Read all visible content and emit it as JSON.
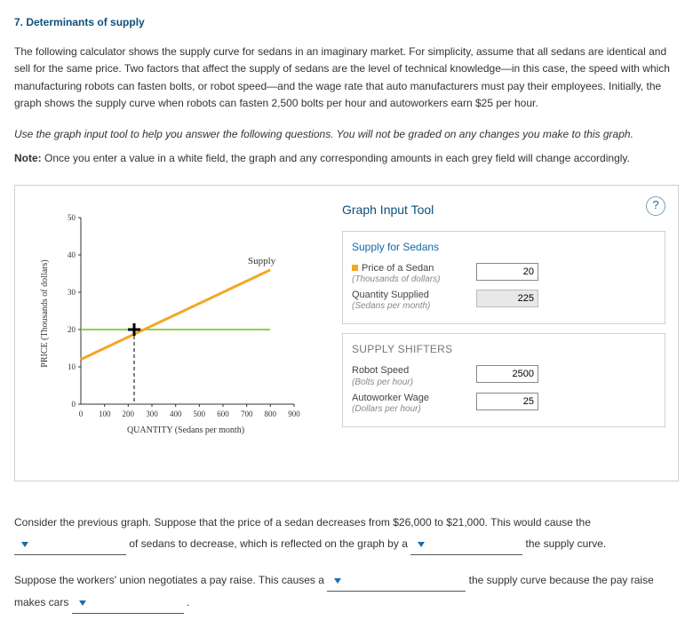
{
  "title": "7. Determinants of supply",
  "intro": "The following calculator shows the supply curve for sedans in an imaginary market. For simplicity, assume that all sedans are identical and sell for the same price. Two factors that affect the supply of sedans are the level of technical knowledge—in this case, the speed with which manufacturing robots can fasten bolts, or robot speed—and the wage rate that auto manufacturers must pay their employees. Initially, the graph shows the supply curve when robots can fasten 2,500 bolts per hour and autoworkers earn $25 per hour.",
  "instructions": "Use the graph input tool to help you answer the following questions. You will not be graded on any changes you make to this graph.",
  "note_label": "Note:",
  "note_text": " Once you enter a value in a white field, the graph and any corresponding amounts in each grey field will change accordingly.",
  "tool": {
    "header": "Graph Input Tool",
    "help": "?",
    "section1_title": "Supply for Sedans",
    "price_label": "Price of a Sedan",
    "price_sub": "(Thousands of dollars)",
    "price_value": "20",
    "qty_label": "Quantity Supplied",
    "qty_sub": "(Sedans per month)",
    "qty_value": "225",
    "section2_title": "SUPPLY SHIFTERS",
    "robot_label": "Robot Speed",
    "robot_sub": "(Bolts per hour)",
    "robot_value": "2500",
    "wage_label": "Autoworker Wage",
    "wage_sub": "(Dollars per hour)",
    "wage_value": "25"
  },
  "chart_data": {
    "type": "line",
    "title": "",
    "xlabel": "QUANTITY (Sedans per month)",
    "ylabel": "PRICE (Thousands of dollars)",
    "xlim": [
      0,
      900
    ],
    "ylim": [
      0,
      50
    ],
    "xticks": [
      0,
      100,
      200,
      300,
      400,
      500,
      600,
      700,
      800,
      900
    ],
    "yticks": [
      0,
      10,
      20,
      30,
      40,
      50
    ],
    "series": [
      {
        "name": "Supply",
        "color": "#f5a623",
        "x": [
          0,
          800
        ],
        "y": [
          12,
          36
        ]
      },
      {
        "name": "PriceLine",
        "color": "#8fd14f",
        "x": [
          0,
          800
        ],
        "y": [
          20,
          20
        ]
      }
    ],
    "marker": {
      "x": 225,
      "y": 20
    },
    "legend": {
      "supply": "Supply"
    }
  },
  "q1_part1": "Consider the previous graph. Suppose that the price of a sedan decreases from $26,000 to $21,000. This would cause the ",
  "q1_part2": " of sedans to decrease, which is reflected on the graph by a ",
  "q1_part3": " the supply curve.",
  "q2_part1": "Suppose the workers' union negotiates a pay raise. This causes a ",
  "q2_part2": " the supply curve because the pay raise makes cars ",
  "q2_part3": " .",
  "blank": " "
}
